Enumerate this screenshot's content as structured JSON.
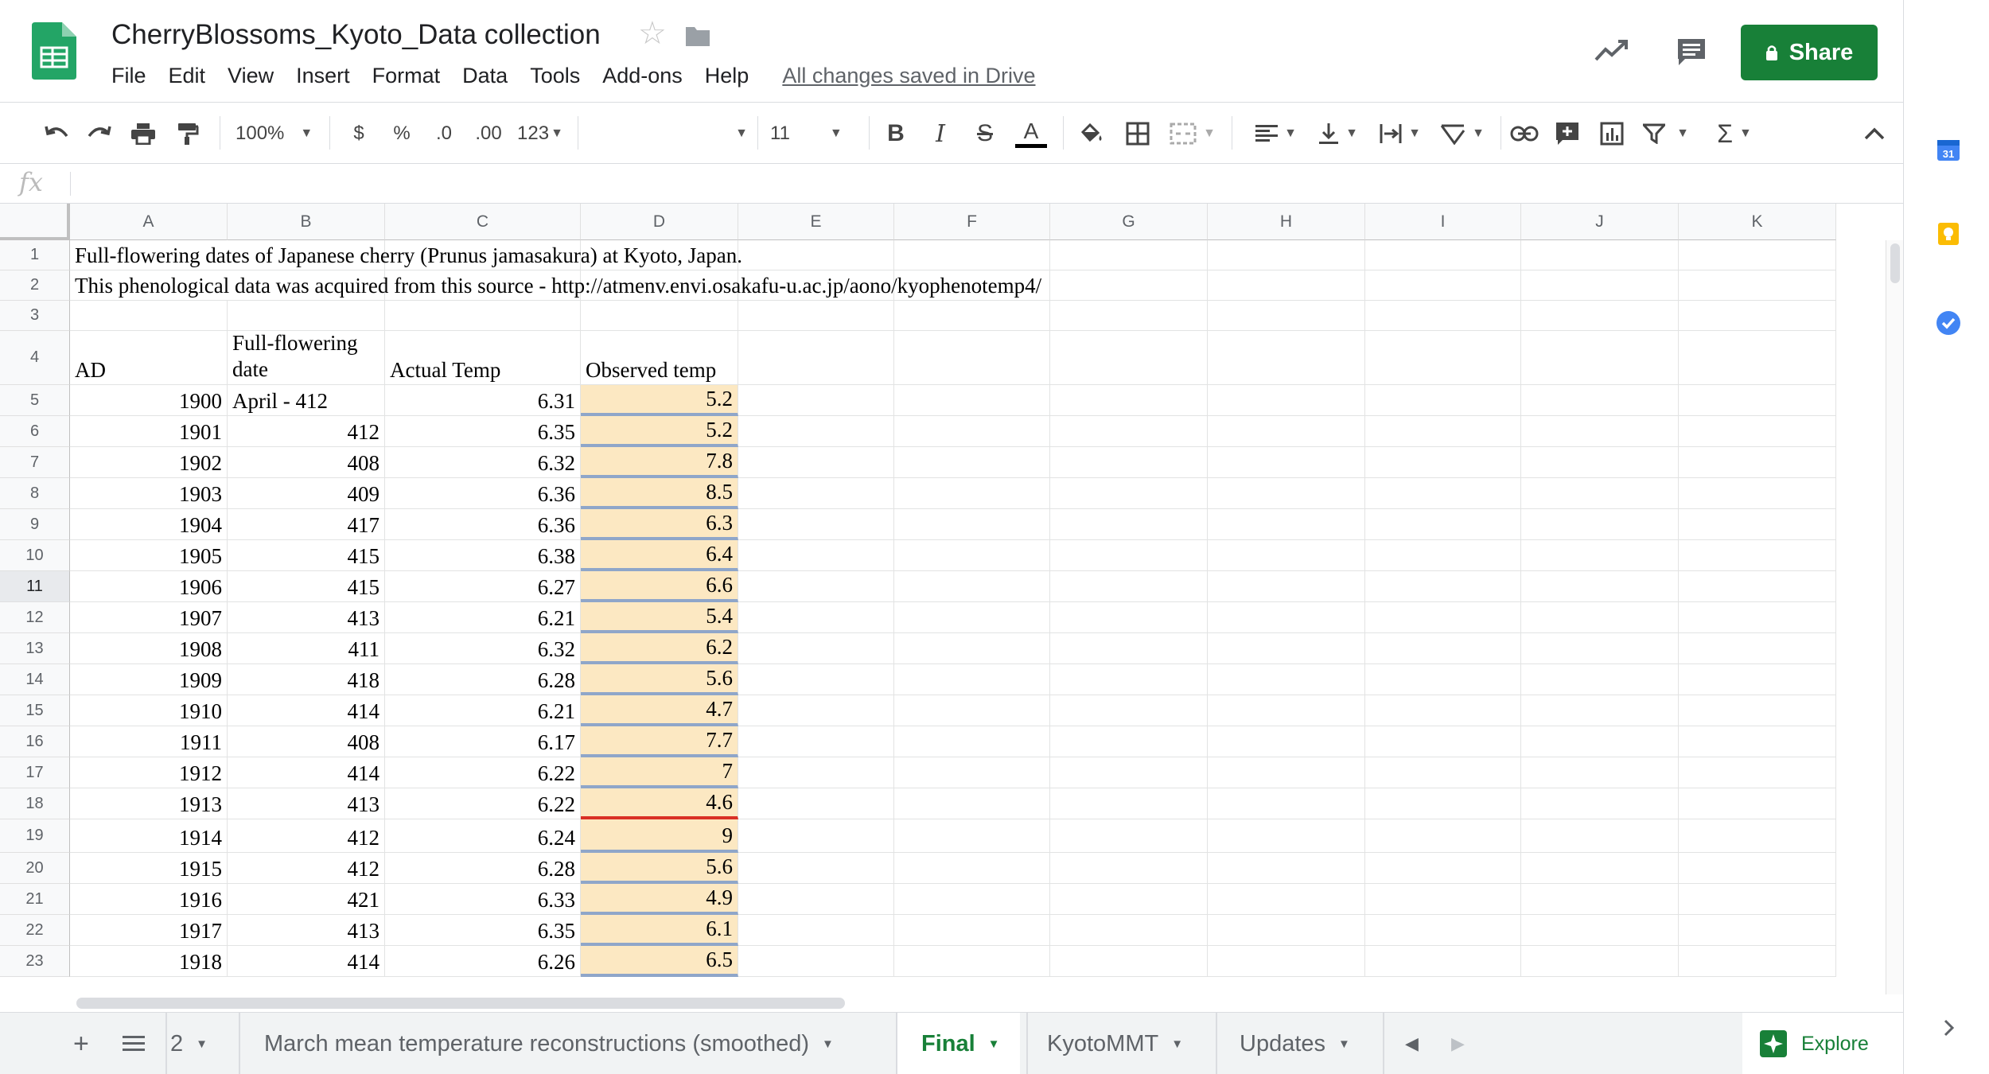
{
  "document": {
    "title": "CherryBlossoms_Kyoto_Data collection",
    "save_status": "All changes saved in Drive"
  },
  "menu": [
    "File",
    "Edit",
    "View",
    "Insert",
    "Format",
    "Data",
    "Tools",
    "Add-ons",
    "Help"
  ],
  "header": {
    "share_label": "Share"
  },
  "toolbar": {
    "zoom": "100%",
    "currency": "$",
    "percent": "%",
    "decrease_decimal": ".0",
    "increase_decimal": ".00",
    "more_formats": "123",
    "font_size": "11"
  },
  "formula_bar": {
    "fx": "fx",
    "content": ""
  },
  "grid": {
    "columns": [
      "A",
      "B",
      "C",
      "D",
      "E",
      "F",
      "G",
      "H",
      "I",
      "J",
      "K"
    ],
    "rows": [
      {
        "n": "1",
        "a": "Full-flowering dates of Japanese cherry (Prunus jamasakura) at Kyoto, Japan.",
        "b": "",
        "c": "",
        "d": ""
      },
      {
        "n": "2",
        "a": "This phenological data was acquired from this source - http://atmenv.envi.osakafu-u.ac.jp/aono/kyophenotemp4/",
        "b": "",
        "c": "",
        "d": ""
      },
      {
        "n": "3",
        "a": "",
        "b": "",
        "c": "",
        "d": ""
      },
      {
        "n": "4",
        "a": "AD",
        "b": "Full-flowering date",
        "c": "Actual Temp",
        "d": "Observed temp"
      },
      {
        "n": "5",
        "a": "1900",
        "b": "April - 412",
        "c": "6.31",
        "d": "5.2"
      },
      {
        "n": "6",
        "a": "1901",
        "b": "412",
        "c": "6.35",
        "d": "5.2"
      },
      {
        "n": "7",
        "a": "1902",
        "b": "408",
        "c": "6.32",
        "d": "7.8"
      },
      {
        "n": "8",
        "a": "1903",
        "b": "409",
        "c": "6.36",
        "d": "8.5"
      },
      {
        "n": "9",
        "a": "1904",
        "b": "417",
        "c": "6.36",
        "d": "6.3"
      },
      {
        "n": "10",
        "a": "1905",
        "b": "415",
        "c": "6.38",
        "d": "6.4"
      },
      {
        "n": "11",
        "a": "1906",
        "b": "415",
        "c": "6.27",
        "d": "6.6"
      },
      {
        "n": "12",
        "a": "1907",
        "b": "413",
        "c": "6.21",
        "d": "5.4"
      },
      {
        "n": "13",
        "a": "1908",
        "b": "411",
        "c": "6.32",
        "d": "6.2"
      },
      {
        "n": "14",
        "a": "1909",
        "b": "418",
        "c": "6.28",
        "d": "5.6"
      },
      {
        "n": "15",
        "a": "1910",
        "b": "414",
        "c": "6.21",
        "d": "4.7"
      },
      {
        "n": "16",
        "a": "1911",
        "b": "408",
        "c": "6.17",
        "d": "7.7"
      },
      {
        "n": "17",
        "a": "1912",
        "b": "414",
        "c": "6.22",
        "d": "7"
      },
      {
        "n": "18",
        "a": "1913",
        "b": "413",
        "c": "6.22",
        "d": "4.6"
      },
      {
        "n": "19",
        "a": "1914",
        "b": "412",
        "c": "6.24",
        "d": "9"
      },
      {
        "n": "20",
        "a": "1915",
        "b": "412",
        "c": "6.28",
        "d": "5.6"
      },
      {
        "n": "21",
        "a": "1916",
        "b": "421",
        "c": "6.33",
        "d": "4.9"
      },
      {
        "n": "22",
        "a": "1917",
        "b": "413",
        "c": "6.35",
        "d": "6.1"
      },
      {
        "n": "23",
        "a": "1918",
        "b": "414",
        "c": "6.26",
        "d": "6.5"
      }
    ]
  },
  "sheet_tabs": [
    {
      "label": "2",
      "active": false
    },
    {
      "label": "March mean temperature reconstructions (smoothed)",
      "active": false
    },
    {
      "label": "Final",
      "active": true
    },
    {
      "label": "KyotoMMT",
      "active": false
    },
    {
      "label": "Updates",
      "active": false
    }
  ],
  "explore_label": "Explore",
  "colors": {
    "brand_green": "#188038",
    "observed_fill": "#fce8c2",
    "observed_border": "#8fa6c9",
    "red_rule": "#d93025"
  }
}
